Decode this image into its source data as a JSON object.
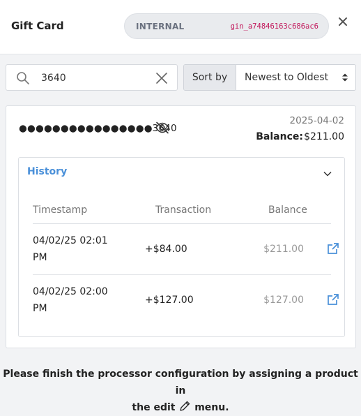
{
  "header": {
    "title": "Gift Card",
    "environment": "INTERNAL",
    "gateway_id": "gin_a74846163c686ac6"
  },
  "search": {
    "value": "3640",
    "placeholder": ""
  },
  "sort": {
    "label": "Sort by",
    "selected": "Newest to Oldest"
  },
  "card": {
    "masked_number": "●●●●●●●●●●●●●●●●3640",
    "date": "2025-04-02",
    "balance_label": "Balance:",
    "balance_value": "$211.00",
    "history": {
      "title": "History",
      "columns": [
        "Timestamp",
        "Transaction",
        "Balance"
      ],
      "rows": [
        {
          "timestamp_line1": "04/02/25 02:01",
          "timestamp_line2": "PM",
          "transaction": "+$84.00",
          "balance": "$211.00"
        },
        {
          "timestamp_line1": "04/02/25 02:00",
          "timestamp_line2": "PM",
          "transaction": "+$127.00",
          "balance": "$127.00"
        }
      ]
    }
  },
  "notice": {
    "line1": "Please finish the processor configuration by assigning a product in",
    "line2_before": "the edit",
    "line2_after": "menu."
  },
  "colors": {
    "accent": "#4a90d9",
    "env_id": "#c2185b"
  },
  "icons": [
    "close-icon",
    "search-icon",
    "clear-icon",
    "sort-caret-icon",
    "eye-slash-icon",
    "chevron-down-icon",
    "external-link-icon",
    "pencil-icon"
  ]
}
